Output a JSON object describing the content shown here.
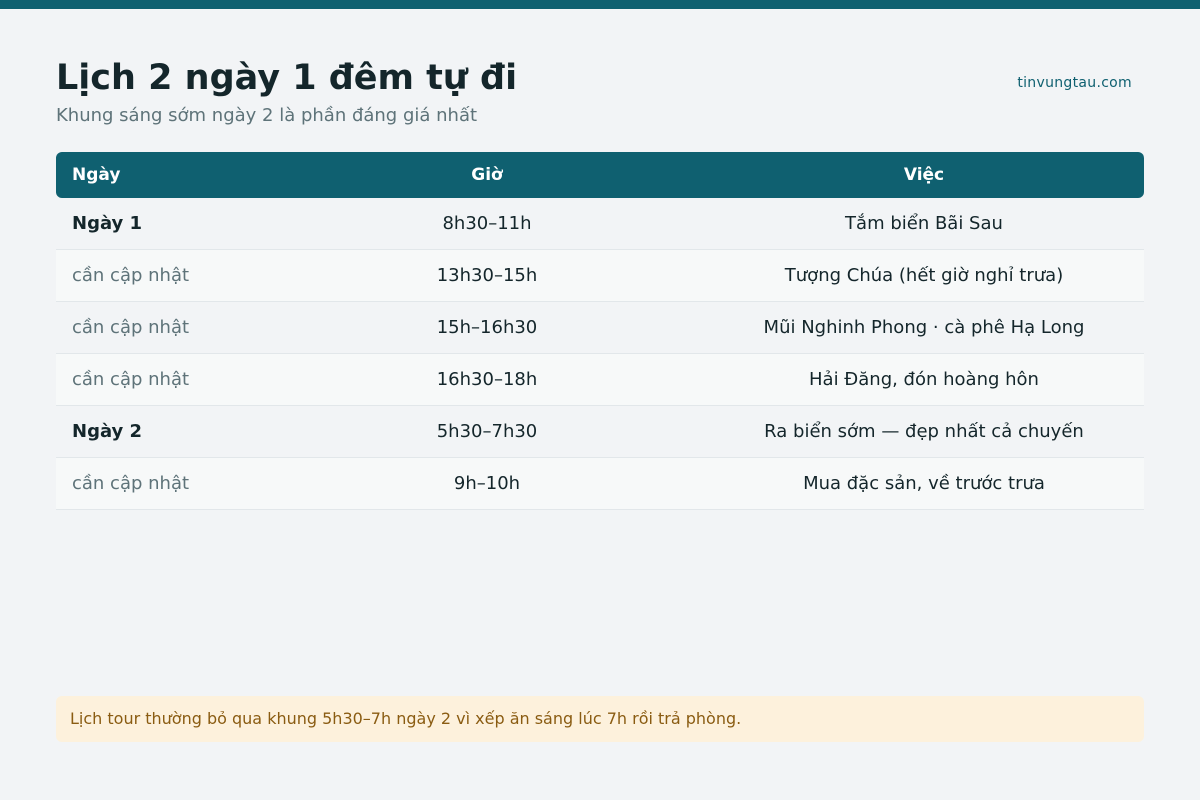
{
  "header": {
    "title": "Lịch 2 ngày 1 đêm tự đi",
    "subtitle": "Khung sáng sớm ngày 2 là phần đáng giá nhất",
    "site": "tinvungtau.com"
  },
  "table": {
    "columns": [
      "Ngày",
      "Giờ",
      "Việc"
    ],
    "rows": [
      {
        "day": "Ngày 1",
        "time": "8h30–11h",
        "task": "Tắm biển Bãi Sau"
      },
      {
        "day": "cần cập nhật",
        "time": "13h30–15h",
        "task": "Tượng Chúa (hết giờ nghỉ trưa)"
      },
      {
        "day": "cần cập nhật",
        "time": "15h–16h30",
        "task": "Mũi Nghinh Phong · cà phê Hạ Long"
      },
      {
        "day": "cần cập nhật",
        "time": "16h30–18h",
        "task": "Hải Đăng, đón hoàng hôn"
      },
      {
        "day": "Ngày 2",
        "time": "5h30–7h30",
        "task": "Ra biển sớm — đẹp nhất cả chuyến"
      },
      {
        "day": "cần cập nhật",
        "time": "9h–10h",
        "task": "Mua đặc sản, về trước trưa"
      }
    ]
  },
  "note": "Lịch tour thường bỏ qua khung 5h30–7h ngày 2 vì xếp ăn sáng lúc 7h rồi trả phòng.",
  "colors": {
    "accent": "#0f6070",
    "background": "#f2f4f6",
    "note_background": "#fdf1dc",
    "note_text": "#8a5c12"
  }
}
